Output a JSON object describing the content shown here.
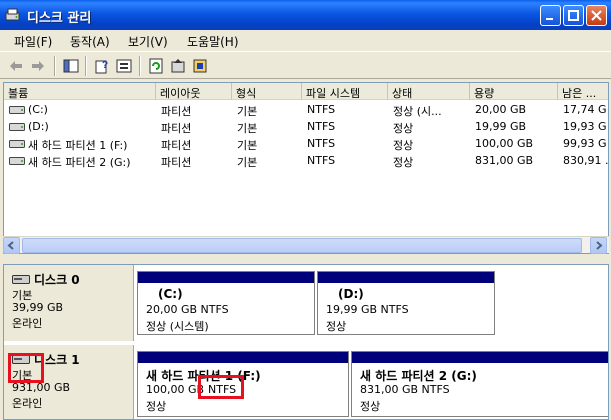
{
  "window": {
    "title": "디스크 관리",
    "icon": "disk-management-icon"
  },
  "menu": [
    {
      "label": "파일(F)"
    },
    {
      "label": "동작(A)"
    },
    {
      "label": "보기(V)"
    },
    {
      "label": "도움말(H)"
    }
  ],
  "toolbar": [
    "back-arrow-icon",
    "forward-arrow-icon",
    "console-tree-icon",
    "properties-icon",
    "help-icon",
    "refresh-icon",
    "export-icon",
    "settings-icon"
  ],
  "list": {
    "columns": [
      "볼륨",
      "레이아웃",
      "형식",
      "파일 시스템",
      "상태",
      "용량",
      "남은 ..."
    ],
    "rows": [
      {
        "volume": "(C:)",
        "layout": "파티션",
        "type": "기본",
        "fs": "NTFS",
        "status": "정상 (시...",
        "capacity": "20,00 GB",
        "free": "17,74 G"
      },
      {
        "volume": "(D:)",
        "layout": "파티션",
        "type": "기본",
        "fs": "NTFS",
        "status": "정상",
        "capacity": "19,99 GB",
        "free": "19,93 G"
      },
      {
        "volume": "새 하드 파티션 1 (F:)",
        "layout": "파티션",
        "type": "기본",
        "fs": "NTFS",
        "status": "정상",
        "capacity": "100,00 GB",
        "free": "99,93 G"
      },
      {
        "volume": "새 하드 파티션 2 (G:)",
        "layout": "파티션",
        "type": "기본",
        "fs": "NTFS",
        "status": "정상",
        "capacity": "831,00 GB",
        "free": "830,91 ."
      }
    ]
  },
  "disks": [
    {
      "name": "디스크 0",
      "kind": "기본",
      "size": "39,99 GB",
      "state": "온라인",
      "partitions": [
        {
          "title": "(C:)",
          "info": "20,00 GB NTFS",
          "status": "정상 (시스템)"
        },
        {
          "title": "(D:)",
          "info": "19,99 GB NTFS",
          "status": "정상"
        }
      ]
    },
    {
      "name": "디스크 1",
      "kind": "기본",
      "size": "931,00 GB",
      "state": "온라인",
      "partitions": [
        {
          "title": "새 하드 파티션 1 (F:)",
          "size": "100,00 GB",
          "fs": "NTFS",
          "status": "정상"
        },
        {
          "title": "새 하드 파티션 2 (G:)",
          "info": "831,00 GB NTFS",
          "status": "정상"
        }
      ]
    }
  ],
  "colors": {
    "titlebar": "#0b56e2",
    "partitionBar": "#00007a",
    "highlight": "#e8101e"
  }
}
